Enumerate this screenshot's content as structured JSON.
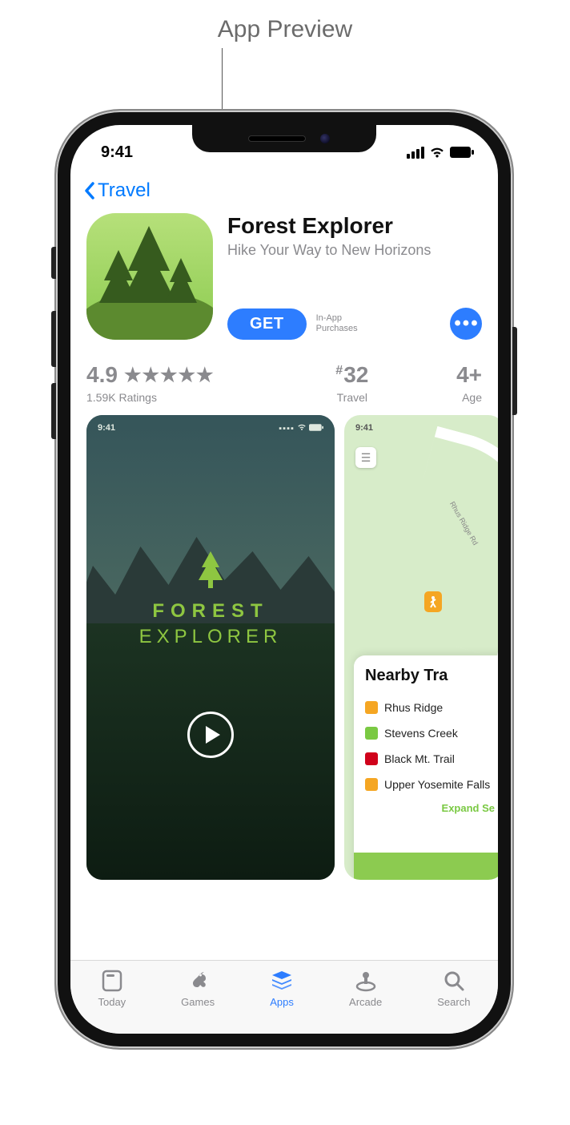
{
  "callout": {
    "label": "App Preview"
  },
  "status": {
    "time": "9:41"
  },
  "nav": {
    "back_label": "Travel"
  },
  "app": {
    "title": "Forest Explorer",
    "subtitle": "Hike Your Way to New Horizons",
    "get_label": "GET",
    "iap_line1": "In-App",
    "iap_line2": "Purchases"
  },
  "meta": {
    "rating_value": "4.9",
    "rating_count": "1.59K Ratings",
    "rank_value": "32",
    "rank_label": "Travel",
    "age_value": "4+",
    "age_label": "Age"
  },
  "preview1": {
    "time": "9:41",
    "title_line1": "FOREST",
    "title_line2": "EXPLORER"
  },
  "preview2": {
    "time": "9:41",
    "road_label": "Rhus Ridge Rd",
    "panel_title": "Nearby Tra",
    "trails": [
      {
        "name": "Rhus Ridge",
        "diff": "o"
      },
      {
        "name": "Stevens Creek",
        "diff": "g"
      },
      {
        "name": "Black Mt. Trail",
        "diff": "r"
      },
      {
        "name": "Upper Yosemite Falls",
        "diff": "o"
      }
    ],
    "expand": "Expand Se"
  },
  "tabs": {
    "today": "Today",
    "games": "Games",
    "apps": "Apps",
    "arcade": "Arcade",
    "search": "Search"
  }
}
